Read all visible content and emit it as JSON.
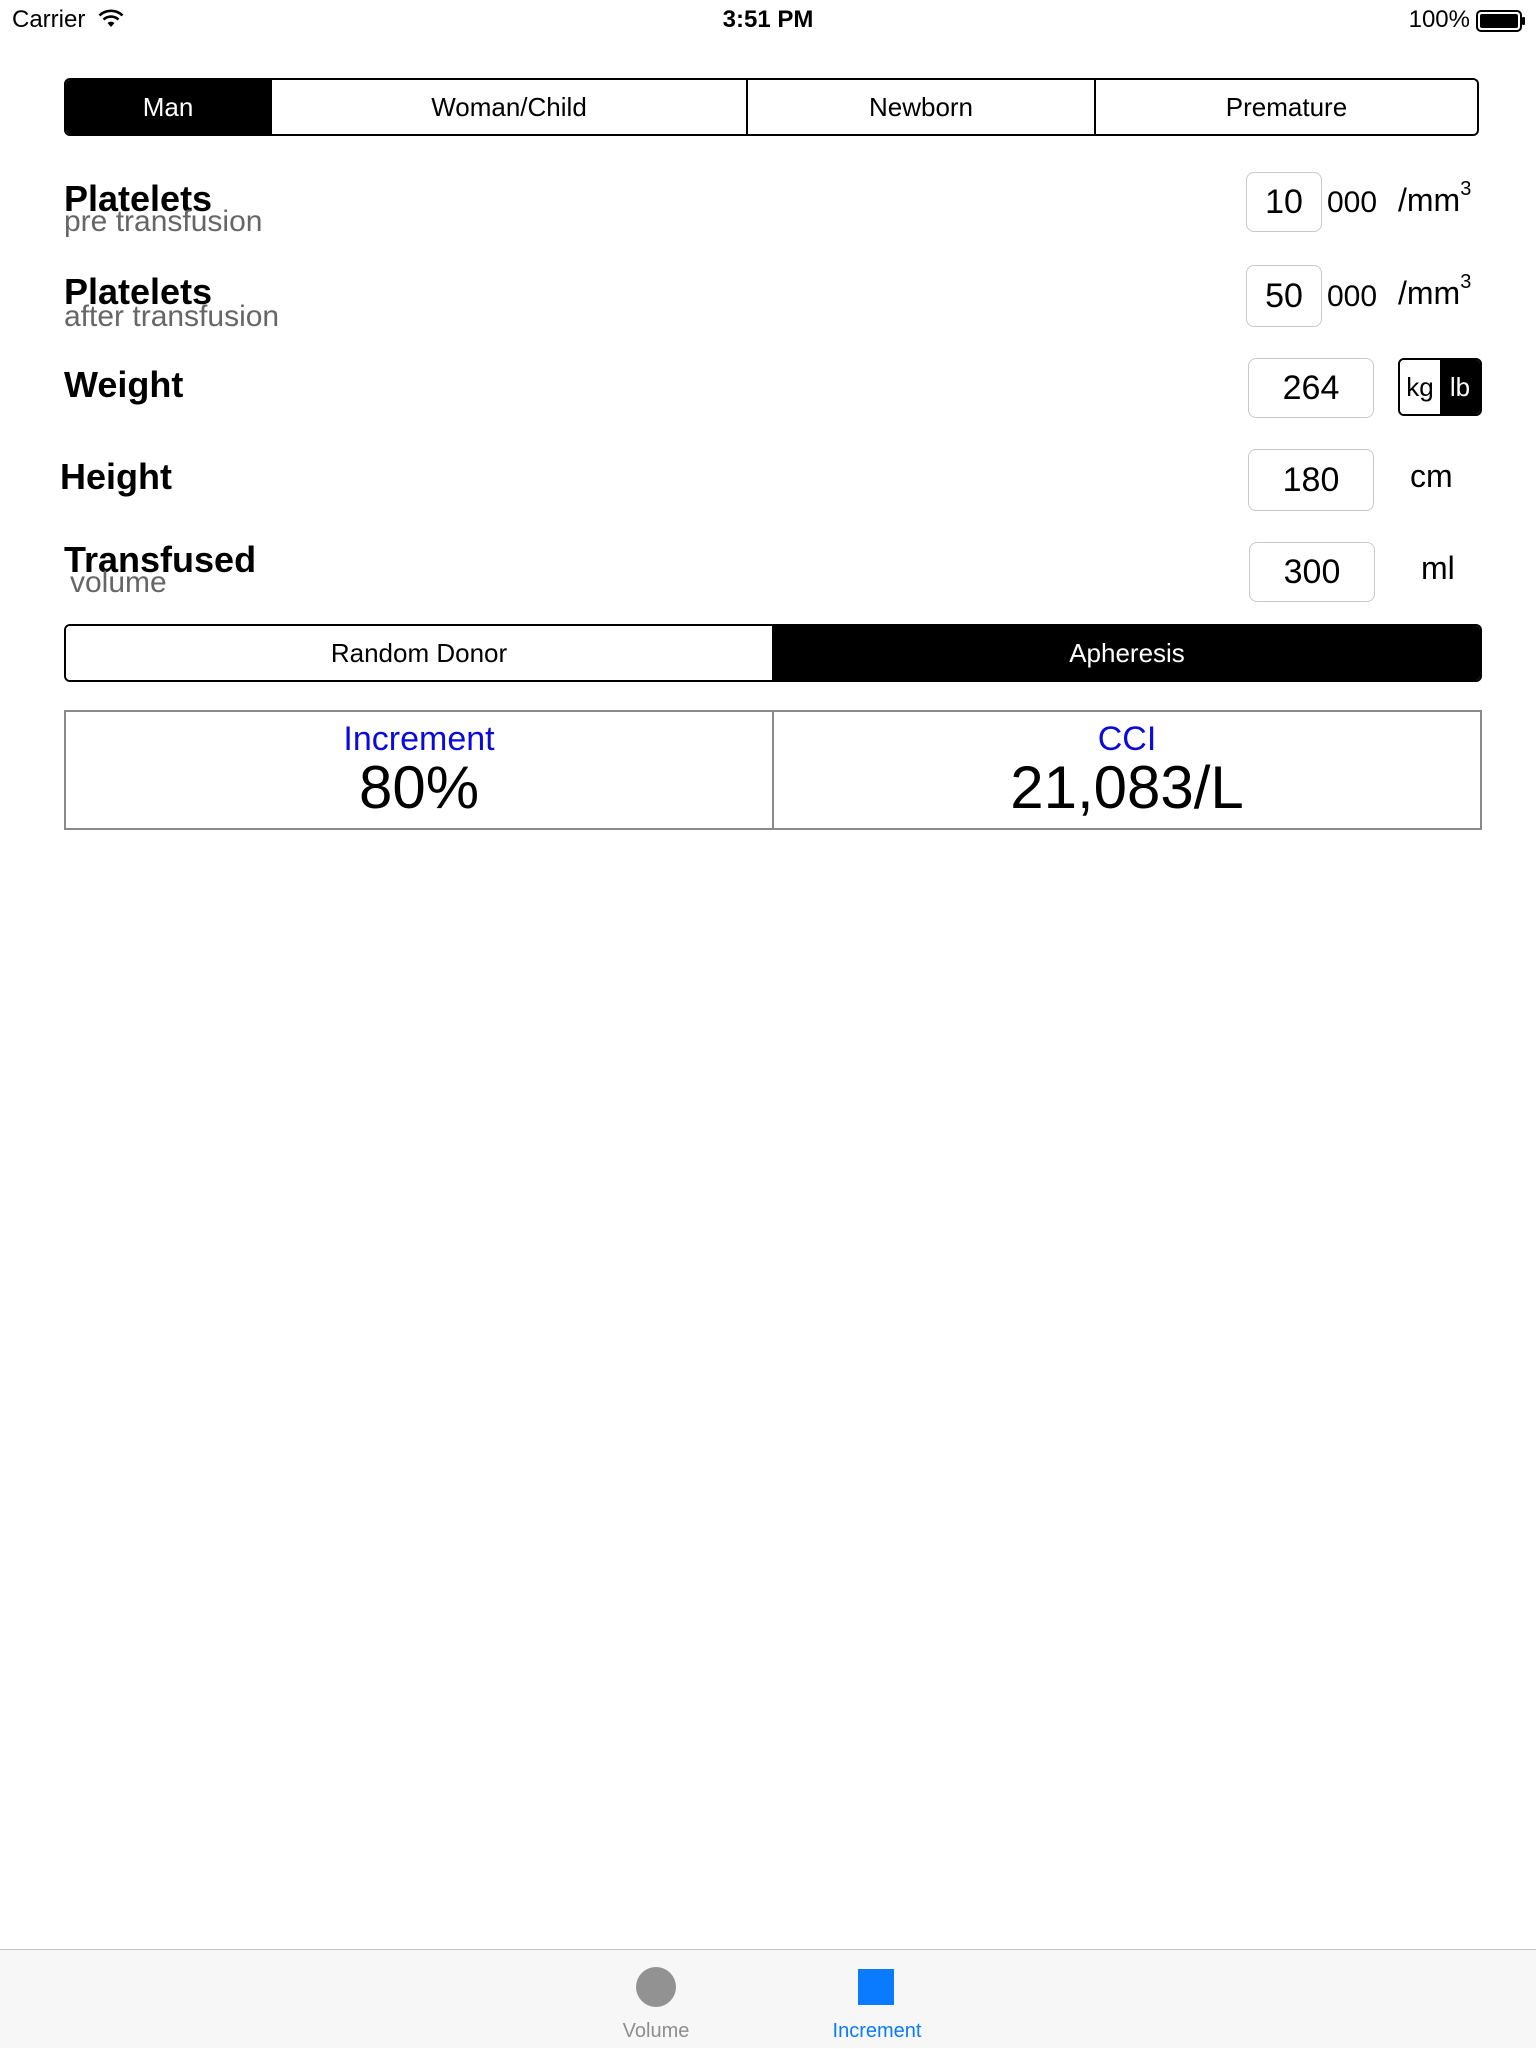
{
  "status_bar": {
    "carrier": "Carrier",
    "time": "3:51 PM",
    "battery": "100%"
  },
  "patient_type": {
    "options": [
      "Man",
      "Woman/Child",
      "Newborn",
      "Premature"
    ],
    "selected": "Man"
  },
  "platelets_pre": {
    "label": "Platelets",
    "sublabel": "pre transfusion",
    "value": "10",
    "suffix": "000",
    "unit": "/mm",
    "unit_sup": "3"
  },
  "platelets_post": {
    "label": "Platelets",
    "sublabel": "after transfusion",
    "value": "50",
    "suffix": "000",
    "unit": "/mm",
    "unit_sup": "3"
  },
  "weight": {
    "label": "Weight",
    "value": "264",
    "units": [
      "kg",
      "lb"
    ],
    "selected_unit": "lb"
  },
  "height": {
    "label": "Height",
    "value": "180",
    "unit": "cm"
  },
  "transfused": {
    "label": "Transfused",
    "sublabel": "volume",
    "value": "300",
    "unit": "ml"
  },
  "donor_type": {
    "options": [
      "Random Donor",
      "Apheresis"
    ],
    "selected": "Apheresis"
  },
  "results": {
    "increment_title": "Increment",
    "increment_value": "80%",
    "cci_title": "CCI",
    "cci_value": "21,083/L"
  },
  "tabs": [
    {
      "label": "Volume",
      "icon": "circle-icon",
      "active": false
    },
    {
      "label": "Increment",
      "icon": "square-icon",
      "active": true
    }
  ],
  "colors": {
    "accent_blue": "#0a7aff",
    "result_title_blue": "#0a0adc",
    "segment_selected": "#000000"
  }
}
